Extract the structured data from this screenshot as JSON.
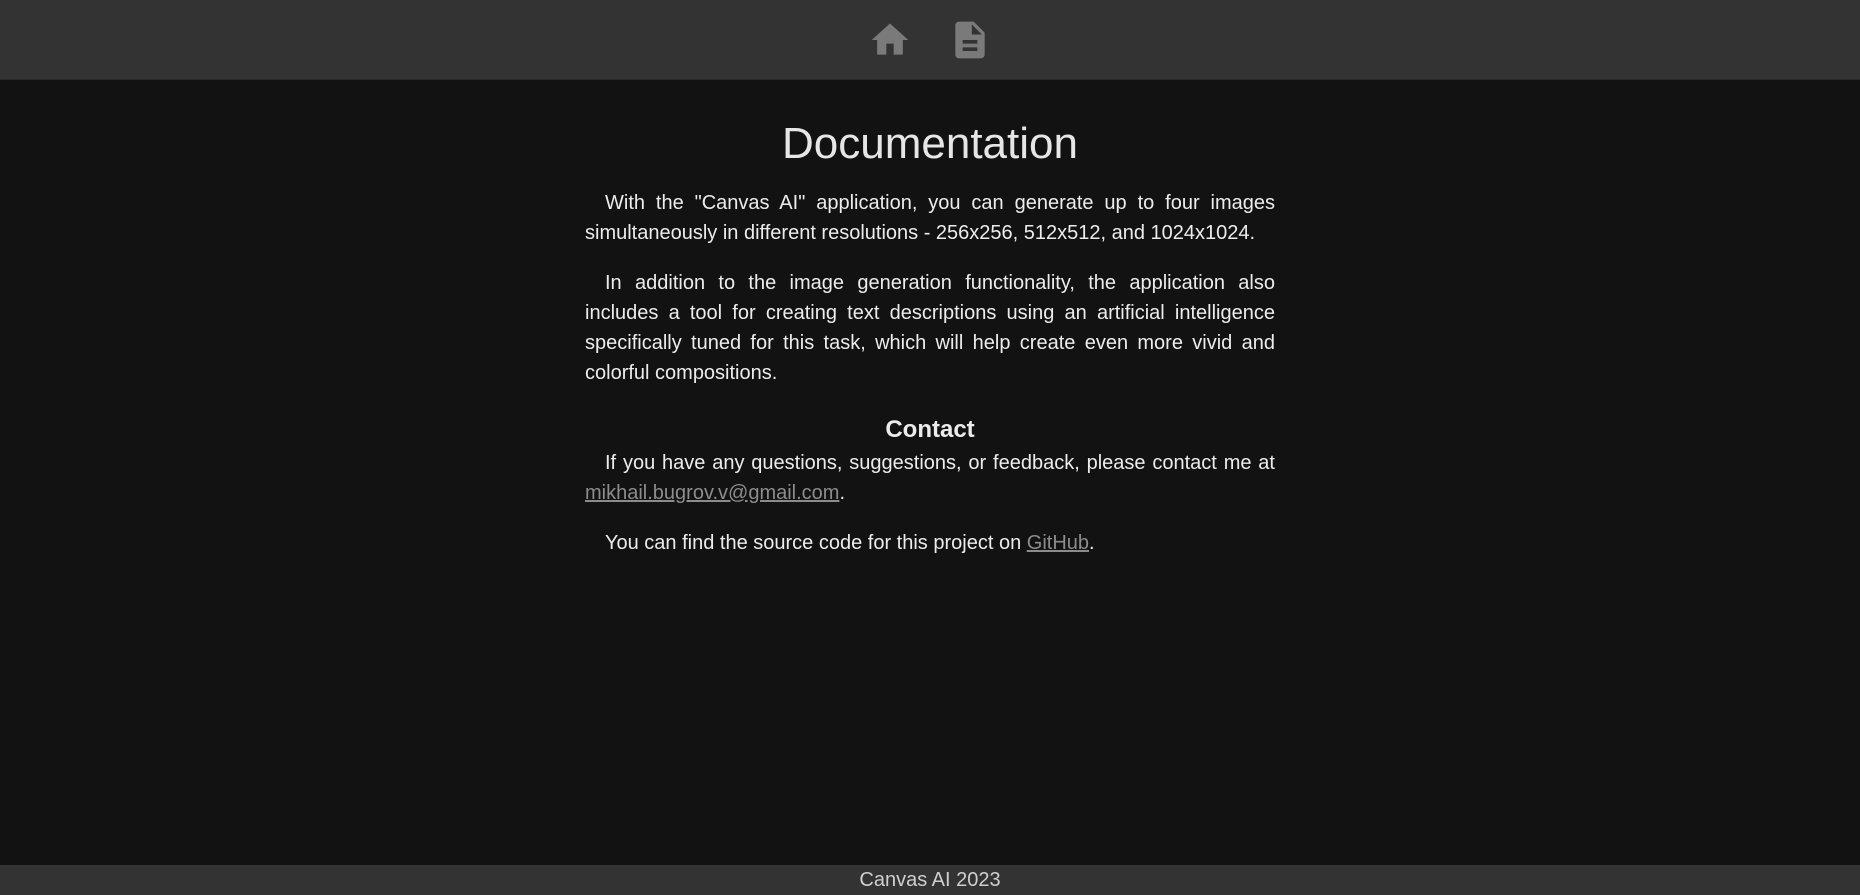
{
  "nav": {
    "home_icon": "home-icon",
    "doc_icon": "document-icon",
    "icon_color": "#7a7a7a"
  },
  "main": {
    "title": "Documentation",
    "paragraph1": "With the \"Canvas AI\" application, you can generate up to four images simultaneously in different resolutions - 256x256, 512x512, and 1024x1024.",
    "paragraph2": "In addition to the image generation functionality, the application also includes a tool for creating text descriptions using an artificial intelligence specifically tuned for this task, which will help create even more vivid and colorful compositions.",
    "contact_heading": "Contact",
    "contact_text": "If you have any questions, suggestions, or feedback, please contact me at",
    "contact_email": "mikhail.bugrov.v@gmail.com",
    "contact_period": ".",
    "source_text": "You can find the source code for this project on",
    "source_link": "GitHub",
    "source_period": "."
  },
  "footer": {
    "text": "Canvas AI 2023"
  }
}
